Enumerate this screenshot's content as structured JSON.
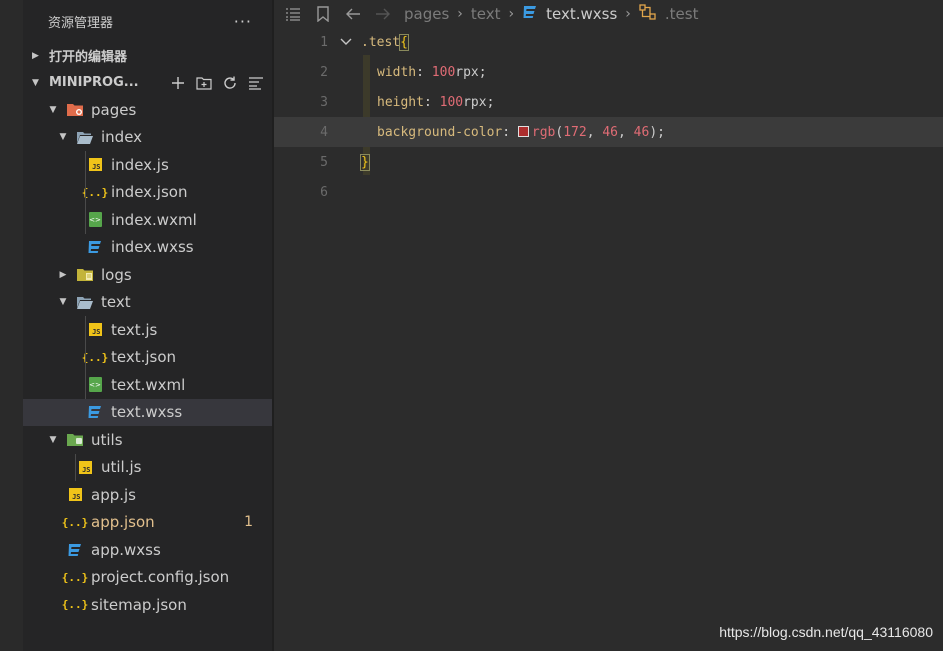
{
  "sidebar": {
    "title": "资源管理器",
    "more": "···",
    "open_editors_label": "打开的编辑器",
    "project_label": "MINIPROG...",
    "tree": [
      {
        "name": "pages",
        "icon": "folder-pages-icon",
        "depth": 0,
        "twisty": "open",
        "type": "folder"
      },
      {
        "name": "index",
        "icon": "folder-open-icon",
        "depth": 1,
        "twisty": "open",
        "type": "folder"
      },
      {
        "name": "index.js",
        "icon": "js-file-icon",
        "depth": 2,
        "type": "js"
      },
      {
        "name": "index.json",
        "icon": "json-file-icon",
        "depth": 2,
        "type": "json"
      },
      {
        "name": "index.wxml",
        "icon": "wxml-file-icon",
        "depth": 2,
        "type": "wxml"
      },
      {
        "name": "index.wxss",
        "icon": "wxss-file-icon",
        "depth": 2,
        "type": "wxss"
      },
      {
        "name": "logs",
        "icon": "folder-logs-icon",
        "depth": 1,
        "twisty": "closed",
        "type": "folder"
      },
      {
        "name": "text",
        "icon": "folder-open-icon",
        "depth": 1,
        "twisty": "open",
        "type": "folder"
      },
      {
        "name": "text.js",
        "icon": "js-file-icon",
        "depth": 2,
        "type": "js"
      },
      {
        "name": "text.json",
        "icon": "json-file-icon",
        "depth": 2,
        "type": "json"
      },
      {
        "name": "text.wxml",
        "icon": "wxml-file-icon",
        "depth": 2,
        "type": "wxml"
      },
      {
        "name": "text.wxss",
        "icon": "wxss-file-icon",
        "depth": 2,
        "type": "wxss",
        "selected": true
      },
      {
        "name": "utils",
        "icon": "folder-utils-icon",
        "depth": 0,
        "twisty": "open",
        "type": "folder"
      },
      {
        "name": "util.js",
        "icon": "js-file-icon",
        "depth": 1,
        "type": "js"
      },
      {
        "name": "app.js",
        "icon": "js-file-icon",
        "depth": 0,
        "type": "js",
        "no_twisty": true
      },
      {
        "name": "app.json",
        "icon": "json-file-icon",
        "depth": 0,
        "type": "json",
        "no_twisty": true,
        "modified": true,
        "badge": "1"
      },
      {
        "name": "app.wxss",
        "icon": "wxss-file-icon",
        "depth": 0,
        "type": "wxss",
        "no_twisty": true
      },
      {
        "name": "project.config.json",
        "icon": "json-file-icon",
        "depth": 0,
        "type": "json",
        "no_twisty": true
      },
      {
        "name": "sitemap.json",
        "icon": "json-file-icon",
        "depth": 0,
        "type": "json",
        "no_twisty": true
      }
    ]
  },
  "breadcrumb": {
    "parts": [
      "pages",
      "text",
      "text.wxss",
      ".test"
    ]
  },
  "code": {
    "line_numbers": [
      "1",
      "2",
      "3",
      "4",
      "5",
      "6"
    ],
    "selector": ".test",
    "open_brace": "{",
    "close_brace": "}",
    "width_prop": "width",
    "width_num": "100",
    "width_unit": "rpx",
    "height_prop": "height",
    "height_num": "100",
    "height_unit": "rpx",
    "bg_prop": "background-color",
    "bg_fn": "rgb",
    "bg_args": "(172, 46, 46)",
    "colon": ": ",
    "semi": ";",
    "swatch_color": "#ac2e2e"
  },
  "watermark": "https://blog.csdn.net/qq_43116080",
  "colors": {
    "accent_modified": "#e2c08d",
    "wxss_icon": "#3b9ae1",
    "js_icon": "#f0c419"
  }
}
